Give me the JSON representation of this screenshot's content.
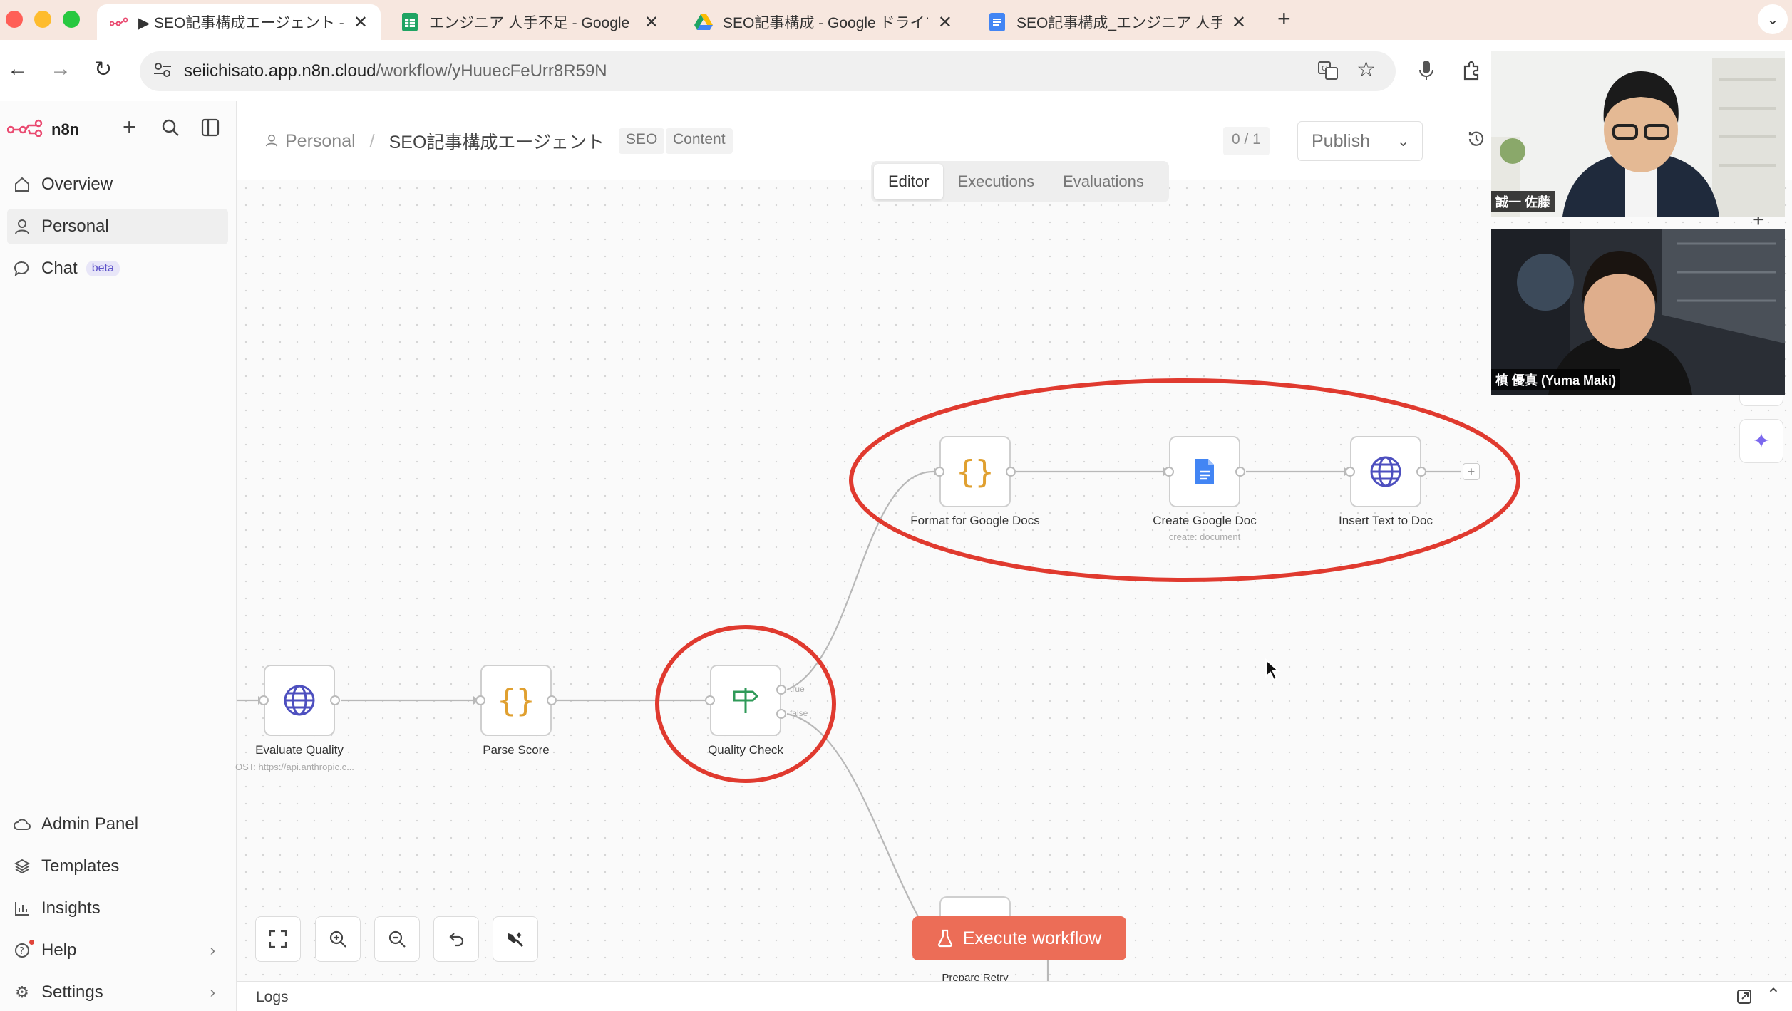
{
  "browser": {
    "tabs": [
      {
        "title": "▶ SEO記事構成エージェント - n"
      },
      {
        "title": "エンジニア 人手不足 - Google ス"
      },
      {
        "title": "SEO記事構成 - Google ドライブ"
      },
      {
        "title": "SEO記事構成_エンジニア 人手不"
      }
    ],
    "url_host": "seiichisato.app.n8n.cloud",
    "url_path": "/workflow/yHuuecFeUrr8R59N"
  },
  "sidebar": {
    "brand": "n8n",
    "top_items": [
      {
        "label": "Overview"
      },
      {
        "label": "Personal"
      },
      {
        "label": "Chat",
        "badge": "beta"
      }
    ],
    "bottom_items": [
      {
        "label": "Admin Panel"
      },
      {
        "label": "Templates"
      },
      {
        "label": "Insights"
      },
      {
        "label": "Help"
      },
      {
        "label": "Settings"
      }
    ]
  },
  "header": {
    "project": "Personal",
    "workflow_name": "SEO記事構成エージェント",
    "tags": [
      "SEO",
      "Content"
    ],
    "counter": "0 / 1",
    "publish_label": "Publish"
  },
  "view_tabs": [
    "Editor",
    "Executions",
    "Evaluations"
  ],
  "nodes": {
    "evaluate": {
      "label": "Evaluate Quality",
      "sub": "OST: https://api.anthropic.c..."
    },
    "parse": {
      "label": "Parse Score"
    },
    "quality": {
      "label": "Quality Check",
      "true_label": "true",
      "false_label": "false"
    },
    "format": {
      "label": "Format for Google Docs"
    },
    "create": {
      "label": "Create Google Doc",
      "sub": "create: document"
    },
    "insert": {
      "label": "Insert Text to Doc"
    },
    "retry": {
      "label": "Prepare Retry"
    }
  },
  "execute_label": "Execute workflow",
  "logs_label": "Logs",
  "participants": [
    {
      "name": "誠一 佐藤"
    },
    {
      "name": "槙 優真 (Yuma Maki)"
    }
  ],
  "colors": {
    "accent": "#ec6d57",
    "annotation": "#e03a2f",
    "globe": "#4d4fbf",
    "code": "#e0a030",
    "if": "#2f9a58",
    "gdoc": "#4285f4"
  }
}
